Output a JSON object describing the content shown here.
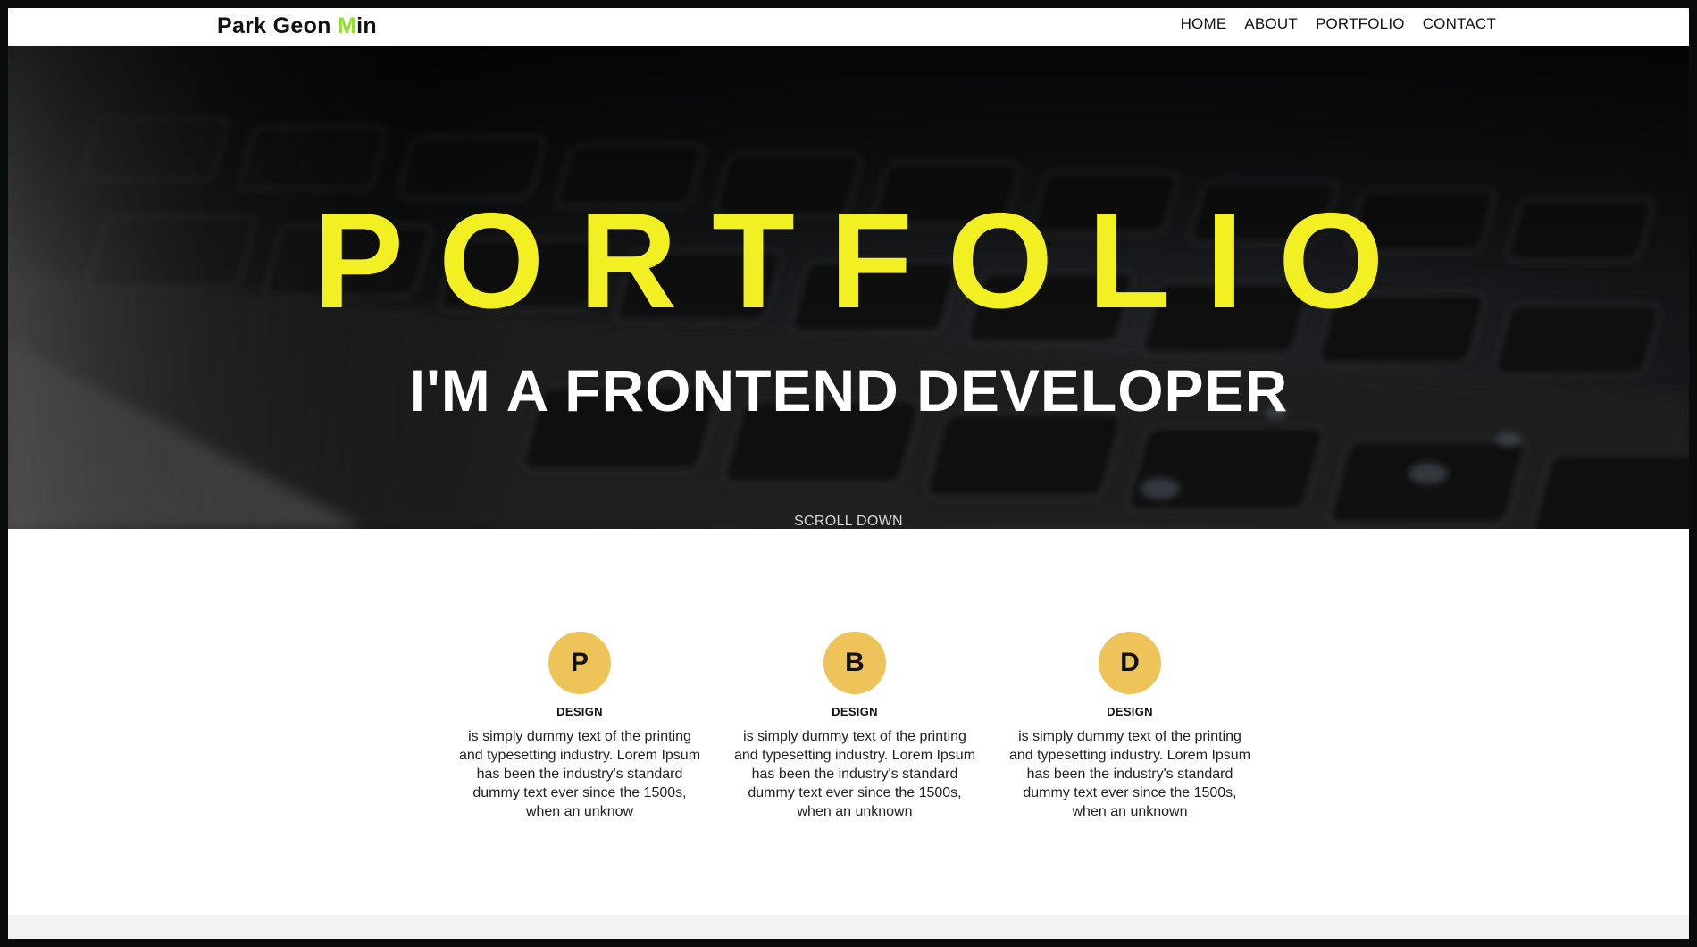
{
  "nav": {
    "logo_main": "Park Geon ",
    "logo_accent": "M",
    "logo_tail": "in",
    "items": [
      {
        "label": "HOME"
      },
      {
        "label": "ABOUT"
      },
      {
        "label": "PORTFOLIO"
      },
      {
        "label": "CONTACT"
      }
    ]
  },
  "hero": {
    "title": "PORTFOLIO",
    "subtitle": "I'M A FRONTEND DEVELOPER",
    "scroll_label": "SCROLL DOWN"
  },
  "features": [
    {
      "letter": "P",
      "title": "DESIGN",
      "text": "is simply dummy text of the printing and typesetting industry. Lorem Ipsum has been the industry's standard dummy text ever since the 1500s, when an unknow"
    },
    {
      "letter": "B",
      "title": "DESIGN",
      "text": "is simply dummy text of the printing and typesetting industry. Lorem Ipsum has been the industry's standard dummy text ever since the 1500s, when an unknown"
    },
    {
      "letter": "D",
      "title": "DESIGN",
      "text": "is simply dummy text of the printing and typesetting industry. Lorem Ipsum has been the industry's standard dummy text ever since the 1500s, when an unknown"
    }
  ],
  "colors": {
    "accent_logo": "#8ee02b",
    "hero_title": "#f2ef23",
    "circle": "#eec35a"
  }
}
